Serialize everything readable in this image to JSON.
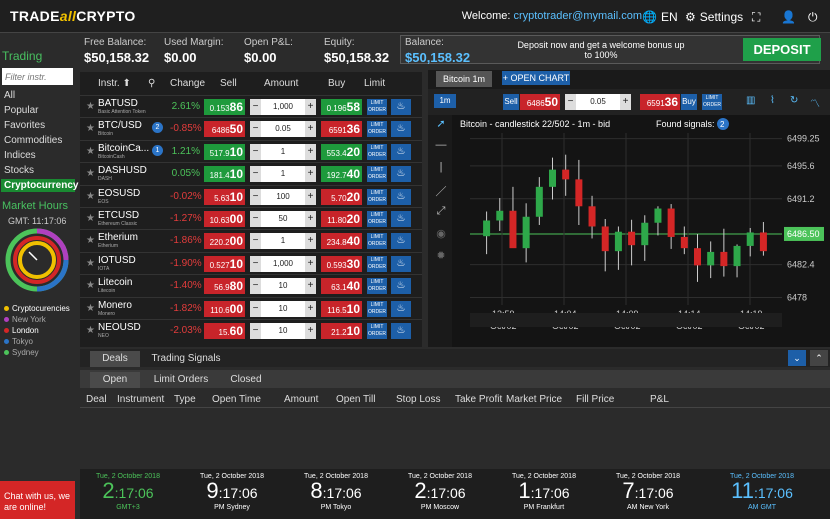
{
  "header": {
    "logo_pre": "TRADE",
    "logo_mid": "all",
    "logo_post": "CRYPTO",
    "welcome_label": "Welcome:",
    "email": "cryptotrader@mymail.com",
    "lang": "EN",
    "settings": "Settings"
  },
  "balances": {
    "free_label": "Free Balance:",
    "free": "$50,158.32",
    "used_label": "Used Margin:",
    "used": "$0.00",
    "pnl_label": "Open P&L:",
    "pnl": "$0.00",
    "equity_label": "Equity:",
    "equity": "$50,158.32",
    "bal_label": "Balance:",
    "bal": "$50,158.32",
    "promo": "Deposit now and get a welcome bonus up to 100%",
    "deposit": "DEPOSIT"
  },
  "sidebar": {
    "title": "Trading",
    "filter_placeholder": "Filter instr.",
    "categories": [
      "All",
      "Popular",
      "Favorites",
      "Commodities",
      "Indices",
      "Stocks",
      "Cryptocurrency"
    ],
    "market_hours": "Market Hours",
    "gmt": "GMT: 11:17:06",
    "legend": [
      {
        "label": "Cryptocurencies",
        "color": "#f0c000"
      },
      {
        "label": "New York",
        "color": "#b040c0"
      },
      {
        "label": "London",
        "color": "#d42626"
      },
      {
        "label": "Tokyo",
        "color": "#2b74c7"
      },
      {
        "label": "Sydney",
        "color": "#4cc35a"
      }
    ]
  },
  "table": {
    "headers": {
      "instr": "Instr.",
      "change": "Change",
      "sell": "Sell",
      "amount": "Amount",
      "buy": "Buy",
      "limit": "Limit"
    },
    "limit_label": "LIMIT ORDER",
    "rows": [
      {
        "name": "BATUSD",
        "sub": "Basic Attention Token",
        "badge": "",
        "change": "2.61%",
        "up": true,
        "sell_small": "0.153",
        "sell_big": "86",
        "amount": "1,000",
        "buy_small": "0.196",
        "buy_big": "58"
      },
      {
        "name": "BTC/USD",
        "sub": "Bitcoin",
        "badge": "2",
        "change": "-0.85%",
        "up": false,
        "sell_small": "6486",
        "sell_big": "50",
        "amount": "0.05",
        "buy_small": "6591",
        "buy_big": "36"
      },
      {
        "name": "BitcoinCa...",
        "sub": "BitcoinCash",
        "badge": "1",
        "change": "1.21%",
        "up": true,
        "sell_small": "517.9",
        "sell_big": "10",
        "amount": "1",
        "buy_small": "553.4",
        "buy_big": "20"
      },
      {
        "name": "DASHUSD",
        "sub": "DASH",
        "badge": "",
        "change": "0.05%",
        "up": true,
        "sell_small": "181.4",
        "sell_big": "10",
        "amount": "1",
        "buy_small": "192.7",
        "buy_big": "40"
      },
      {
        "name": "EOSUSD",
        "sub": "EOS",
        "badge": "",
        "change": "-0.02%",
        "up": false,
        "sell_small": "5.63",
        "sell_big": "10",
        "amount": "100",
        "buy_small": "5.70",
        "buy_big": "20"
      },
      {
        "name": "ETCUSD",
        "sub": "Ethereum Classic",
        "badge": "",
        "change": "-1.27%",
        "up": false,
        "sell_small": "10.63",
        "sell_big": "00",
        "amount": "50",
        "buy_small": "11.80",
        "buy_big": "20"
      },
      {
        "name": "Etherium",
        "sub": "Etherium",
        "badge": "",
        "change": "-1.86%",
        "up": false,
        "sell_small": "220.2",
        "sell_big": "00",
        "amount": "1",
        "buy_small": "234.8",
        "buy_big": "40"
      },
      {
        "name": "IOTUSD",
        "sub": "IOTA",
        "badge": "",
        "change": "-1.90%",
        "up": false,
        "sell_small": "0.527",
        "sell_big": "10",
        "amount": "1,000",
        "buy_small": "0.593",
        "buy_big": "30"
      },
      {
        "name": "Litecoin",
        "sub": "Litecoin",
        "badge": "",
        "change": "-1.40%",
        "up": false,
        "sell_small": "56.9",
        "sell_big": "80",
        "amount": "10",
        "buy_small": "63.1",
        "buy_big": "40"
      },
      {
        "name": "Monero",
        "sub": "Monero",
        "badge": "",
        "change": "-1.82%",
        "up": false,
        "sell_small": "110.6",
        "sell_big": "00",
        "amount": "10",
        "buy_small": "116.5",
        "buy_big": "10"
      },
      {
        "name": "NEOUSD",
        "sub": "NEO",
        "badge": "",
        "change": "-2.03%",
        "up": false,
        "sell_small": "15.",
        "sell_big": "60",
        "amount": "10",
        "buy_small": "21.2",
        "buy_big": "10"
      }
    ]
  },
  "chart": {
    "tab": "Bitcoin 1m",
    "open_chart": "+ OPEN CHART",
    "sell_label": "Sell",
    "sell_small": "6486",
    "sell_big": "50",
    "amount": "0.05",
    "buy_small": "6591",
    "buy_big": "36",
    "buy_label": "Buy",
    "limit_label": "LIMIT ORDER",
    "title": "Bitcoin - candlestick 22/502 - 1m - bid",
    "found": "Found signals:",
    "found_count": "2",
    "tf": "1m",
    "current": "6486.50"
  },
  "chart_data": {
    "type": "candlestick",
    "title": "Bitcoin - candlestick 22/502 - 1m - bid",
    "ylim": [
      6477,
      6500
    ],
    "y_ticks": [
      6499.25,
      6495.6,
      6491.2,
      6486.5,
      6482.4,
      6478.0
    ],
    "x_ticks": [
      {
        "time": "13:59",
        "date": "Oct/02"
      },
      {
        "time": "14:04",
        "date": "Oct/02"
      },
      {
        "time": "14:09",
        "date": "Oct/02"
      },
      {
        "time": "14:14",
        "date": "Oct/02"
      },
      {
        "time": "14:19",
        "date": "Oct/02"
      }
    ],
    "candles": [
      {
        "o": 6486.2,
        "h": 6489.5,
        "l": 6483.8,
        "c": 6488.3
      },
      {
        "o": 6488.3,
        "h": 6491.3,
        "l": 6486.9,
        "c": 6489.6
      },
      {
        "o": 6489.6,
        "h": 6492.8,
        "l": 6487.7,
        "c": 6484.6
      },
      {
        "o": 6484.6,
        "h": 6490.6,
        "l": 6482.7,
        "c": 6488.8
      },
      {
        "o": 6488.8,
        "h": 6494.1,
        "l": 6487.7,
        "c": 6492.8
      },
      {
        "o": 6492.8,
        "h": 6496.7,
        "l": 6491.1,
        "c": 6495.1
      },
      {
        "o": 6495.1,
        "h": 6497.1,
        "l": 6491.6,
        "c": 6493.8
      },
      {
        "o": 6493.8,
        "h": 6496.4,
        "l": 6487.7,
        "c": 6490.2
      },
      {
        "o": 6490.2,
        "h": 6491.6,
        "l": 6485.9,
        "c": 6487.5
      },
      {
        "o": 6487.5,
        "h": 6488.5,
        "l": 6481.5,
        "c": 6484.2
      },
      {
        "o": 6484.2,
        "h": 6487.5,
        "l": 6481.7,
        "c": 6486.8
      },
      {
        "o": 6486.8,
        "h": 6488.4,
        "l": 6482.3,
        "c": 6485.0
      },
      {
        "o": 6485.0,
        "h": 6489.0,
        "l": 6482.9,
        "c": 6488.0
      },
      {
        "o": 6488.0,
        "h": 6490.2,
        "l": 6486.3,
        "c": 6489.9
      },
      {
        "o": 6489.9,
        "h": 6490.5,
        "l": 6484.5,
        "c": 6486.1
      },
      {
        "o": 6486.1,
        "h": 6487.5,
        "l": 6483.8,
        "c": 6484.6
      },
      {
        "o": 6484.6,
        "h": 6486.5,
        "l": 6480.1,
        "c": 6482.3
      },
      {
        "o": 6482.3,
        "h": 6485.5,
        "l": 6480.6,
        "c": 6484.1
      },
      {
        "o": 6484.1,
        "h": 6487.2,
        "l": 6480.8,
        "c": 6482.2
      },
      {
        "o": 6482.2,
        "h": 6485.1,
        "l": 6480.7,
        "c": 6484.9
      },
      {
        "o": 6484.9,
        "h": 6487.3,
        "l": 6483.5,
        "c": 6486.7
      },
      {
        "o": 6486.7,
        "h": 6488.1,
        "l": 6483.6,
        "c": 6484.2
      }
    ]
  },
  "bottom": {
    "tab_deals": "Deals",
    "tab_signals": "Trading Signals",
    "sub_open": "Open",
    "sub_limit": "Limit Orders",
    "sub_closed": "Closed",
    "columns": [
      "Deal",
      "Instrument",
      "Type",
      "Open Time",
      "Amount",
      "Open Till",
      "Stop Loss",
      "Take Profit",
      "Market Price",
      "Fill Price",
      "P&L"
    ]
  },
  "clocks": [
    {
      "date": "Tue, 2 October 2018",
      "hour": "2",
      "min": ":17:06",
      "ampm": "",
      "city": "GMT+3",
      "color": "#4cc35a"
    },
    {
      "date": "Tue, 2 October 2018",
      "hour": "9",
      "min": ":17:06",
      "ampm": "PM",
      "city": "Sydney",
      "color": "#fff"
    },
    {
      "date": "Tue, 2 October 2018",
      "hour": "8",
      "min": ":17:06",
      "ampm": "PM",
      "city": "Tokyo",
      "color": "#fff"
    },
    {
      "date": "Tue, 2 October 2018",
      "hour": "2",
      "min": ":17:06",
      "ampm": "PM",
      "city": "Moscow",
      "color": "#fff"
    },
    {
      "date": "Tue, 2 October 2018",
      "hour": "1",
      "min": ":17:06",
      "ampm": "PM",
      "city": "Frankfurt",
      "color": "#fff"
    },
    {
      "date": "Tue, 2 October 2018",
      "hour": "7",
      "min": ":17:06",
      "ampm": "AM",
      "city": "New York",
      "color": "#fff"
    },
    {
      "date": "Tue, 2 October 2018",
      "hour": "11",
      "min": ":17:06",
      "ampm": "AM",
      "city": "GMT",
      "color": "#5bc0ff"
    }
  ],
  "chat": "Chat with us, we are online!"
}
